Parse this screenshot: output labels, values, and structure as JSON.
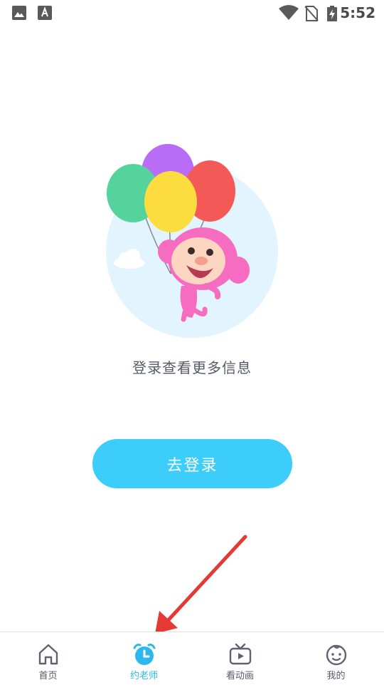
{
  "status_bar": {
    "time": "5:52"
  },
  "main": {
    "message": "登录查看更多信息",
    "login_button_label": "去登录"
  },
  "bottom_nav": {
    "items": [
      {
        "label": "首页",
        "icon": "home-icon",
        "active": false
      },
      {
        "label": "约老师",
        "icon": "alarm-clock-icon",
        "active": true
      },
      {
        "label": "看动画",
        "icon": "tv-icon",
        "active": false
      },
      {
        "label": "我的",
        "icon": "baby-face-icon",
        "active": false
      }
    ]
  },
  "colors": {
    "accent": "#3ccdfa",
    "active_tab": "#2cb8ee",
    "annotation_arrow": "#e53935"
  }
}
